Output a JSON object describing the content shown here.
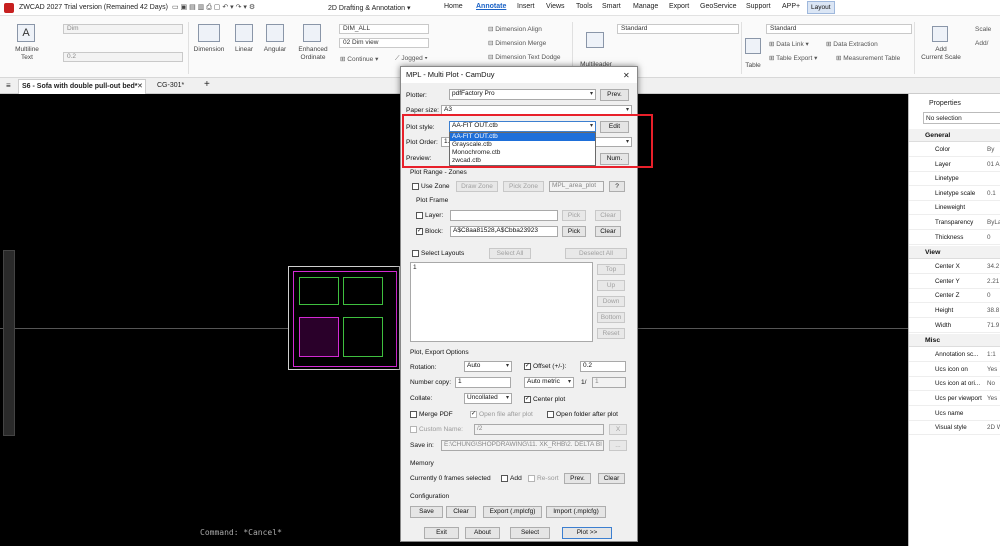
{
  "app": {
    "title": "ZWCAD 2027 Trial version (Remained 42 Days)",
    "workspace": "2D Drafting & Annotation"
  },
  "menu": [
    "Home",
    "Annotate",
    "Insert",
    "Views",
    "Tools",
    "Smart",
    "Manage",
    "Export",
    "GeoService",
    "Support",
    "APP+",
    "Layout"
  ],
  "ribbon": {
    "multiline_text": "Multiline\nText",
    "dim_style": "Dim",
    "dim_scale": "0.2",
    "dimension": "Dimension",
    "linear": "Linear",
    "angular": "Angular",
    "enhanced_ordinate": "Enhanced\nOrdinate",
    "dim_layer": "DIM_ALL",
    "dim_view": "02 Dim view",
    "continue": "Continue",
    "jogged": "Jogged",
    "dim_align": "Dimension Align",
    "dim_merge": "Dimension Merge",
    "dim_text_dodge": "Dimension Text Dodge",
    "multileader": "Multileader",
    "mleader_style": "Standard",
    "table": "Table",
    "table_style": "Standard",
    "data_link": "Data Link",
    "data_extraction": "Data Extraction",
    "table_export": "Table Export",
    "measurement_table": "Measurement Table",
    "add_current_scale": "Add\nCurrent Scale",
    "scale": "Scale",
    "add": "Add/"
  },
  "doc_tabs": [
    {
      "label": "S6 - Sofa with double pull-out bed*"
    },
    {
      "label": "CG-301*"
    }
  ],
  "command_line": "Command: *Cancel*",
  "dialog": {
    "title": "MPL - Multi Plot - CamDuy",
    "plotter_label": "Plotter:",
    "plotter_value": "pdfFactory Pro",
    "prev_button": "Prev.",
    "paper_size_label": "Paper size:",
    "paper_size_value": "A3",
    "plot_style_label": "Plot style:",
    "plot_style_value": "AA-FIT OUT.ctb",
    "plot_style_options": [
      "AA-FIT OUT.ctb",
      "Grayscale.ctb",
      "Monochrome.ctb",
      "zwcad.ctb"
    ],
    "edit_button": "Edit",
    "plot_order_label": "Plot Order:",
    "plot_order_value": "1.",
    "preview_label": "Preview:",
    "num_button": "Num.",
    "plot_range_title": "Plot Range - Zones",
    "use_zone": "Use Zone",
    "draw_zone": "Draw Zone",
    "pick_zone": "Pick Zone",
    "zone_layer": "MPL_area_plot",
    "help_button": "?",
    "plot_frame_title": "Plot Frame",
    "layer_label": "Layer:",
    "layer_value": "",
    "pick_button": "Pick",
    "clear_button": "Clear",
    "block_label": "Block:",
    "block_value": "A$C8aa81528,A$Cbba23923",
    "select_layouts": "Select Layouts",
    "select_all": "Select All",
    "deselect_all": "Deselect All",
    "list_first": "1",
    "top_button": "Top",
    "up_button": "Up",
    "down_button": "Down",
    "bottom_button": "Bottom",
    "reset_button": "Reset",
    "export_title": "Plot, Export Options",
    "rotation_label": "Rotation:",
    "rotation_value": "Auto",
    "offset_label": "Offset (+/-):",
    "offset_value": "0.2",
    "copies_label": "Number copy:",
    "copies_value": "1",
    "metric_value": "Auto metric",
    "ratio_label": "1/",
    "ratio_value": "1",
    "collate_label": "Collate:",
    "collate_value": "Uncollated",
    "center_plot": "Center plot",
    "merge_pdf": "Merge PDF",
    "open_file": "Open file after plot",
    "open_folder": "Open folder after plot",
    "custom_name_label": "Custom Name:",
    "custom_name_value": "/2",
    "x_button": "X",
    "save_in_label": "Save in:",
    "save_in_value": "E:\\CHUNG\\SHOPDRAWING\\11. XK_RHB\\2. DELTA BI",
    "browse_button": "...",
    "memory_title": "Memory",
    "frames_selected": "Currently 0 frames selected",
    "add_label": "Add",
    "resort_label": "Re-sort",
    "prev_mem_button": "Prev.",
    "clear_mem_button": "Clear",
    "config_title": "Configuration",
    "save_button": "Save",
    "clear_cfg_button": "Clear",
    "export_button": "Export (.mplcfg)",
    "import_button": "Import (.mplcfg)",
    "exit_button": "Exit",
    "about_button": "About",
    "select_button": "Select",
    "plot_button": "Plot >>",
    "close": "✕",
    "highlight_color": "#e8202a"
  },
  "properties": {
    "title": "Properties",
    "selection": "No selection",
    "sections": [
      {
        "name": "General",
        "rows": [
          [
            "Color",
            "By"
          ],
          [
            "Layer",
            "01 A"
          ],
          [
            "Linetype",
            ""
          ],
          [
            "Linetype scale",
            "0.1"
          ],
          [
            "Lineweight",
            ""
          ],
          [
            "Transparency",
            "ByLa"
          ],
          [
            "Thickness",
            "0"
          ]
        ]
      },
      {
        "name": "View",
        "rows": [
          [
            "Center X",
            "34.2"
          ],
          [
            "Center Y",
            "2.21"
          ],
          [
            "Center Z",
            "0"
          ],
          [
            "Height",
            "38.8"
          ],
          [
            "Width",
            "71.9"
          ]
        ]
      },
      {
        "name": "Misc",
        "rows": [
          [
            "Annotation sc...",
            "1:1"
          ],
          [
            "Ucs icon on",
            "Yes"
          ],
          [
            "Ucs icon at ori...",
            "No"
          ],
          [
            "Ucs per viewport",
            "Yes"
          ],
          [
            "Ucs name",
            ""
          ],
          [
            "Visual style",
            "2D W"
          ]
        ]
      }
    ]
  }
}
